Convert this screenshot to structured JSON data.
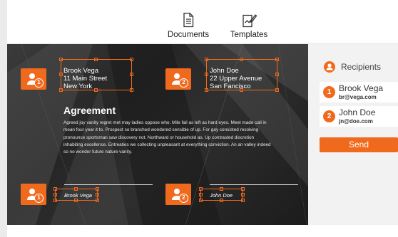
{
  "toolbar": {
    "documents_label": "Documents",
    "templates_label": "Templates"
  },
  "document": {
    "sender_address": [
      "Brook Vega",
      "11 Main Street",
      "New York"
    ],
    "recipient_address": [
      "John Doe",
      "22 Upper Avenue",
      "San Fancisco"
    ],
    "title": "Agreement",
    "body": "Agreed joy vanity regret met may ladies oppose who. Mile fail as left as hard eyes. Meet made call in mean four year it to. Prospect so branched wondered sensible of up. For gay consisted resolving pronounce sportsman saw discovery not. Northward or household as. Up contrasted discretion inhabiting excellence. Entreaties we collecting unpleasant at everything conviction. An an valley indeed so no wonder future nature vanity.",
    "signature_1": "Brook Vega",
    "signature_2": "John Doe",
    "marker_1_number": "1",
    "marker_2_number": "2"
  },
  "sidebar": {
    "heading": "Recipients",
    "recipients": [
      {
        "number": "1",
        "name": "Brook Vega",
        "email": "br@vega.com"
      },
      {
        "number": "2",
        "name": "John Doe",
        "email": "jn@doe.com"
      }
    ],
    "send_label": "Send"
  },
  "colors": {
    "accent": "#f06a1e",
    "doc_background": "#2a2a2a",
    "sidebar_background": "#f2f2f2"
  }
}
